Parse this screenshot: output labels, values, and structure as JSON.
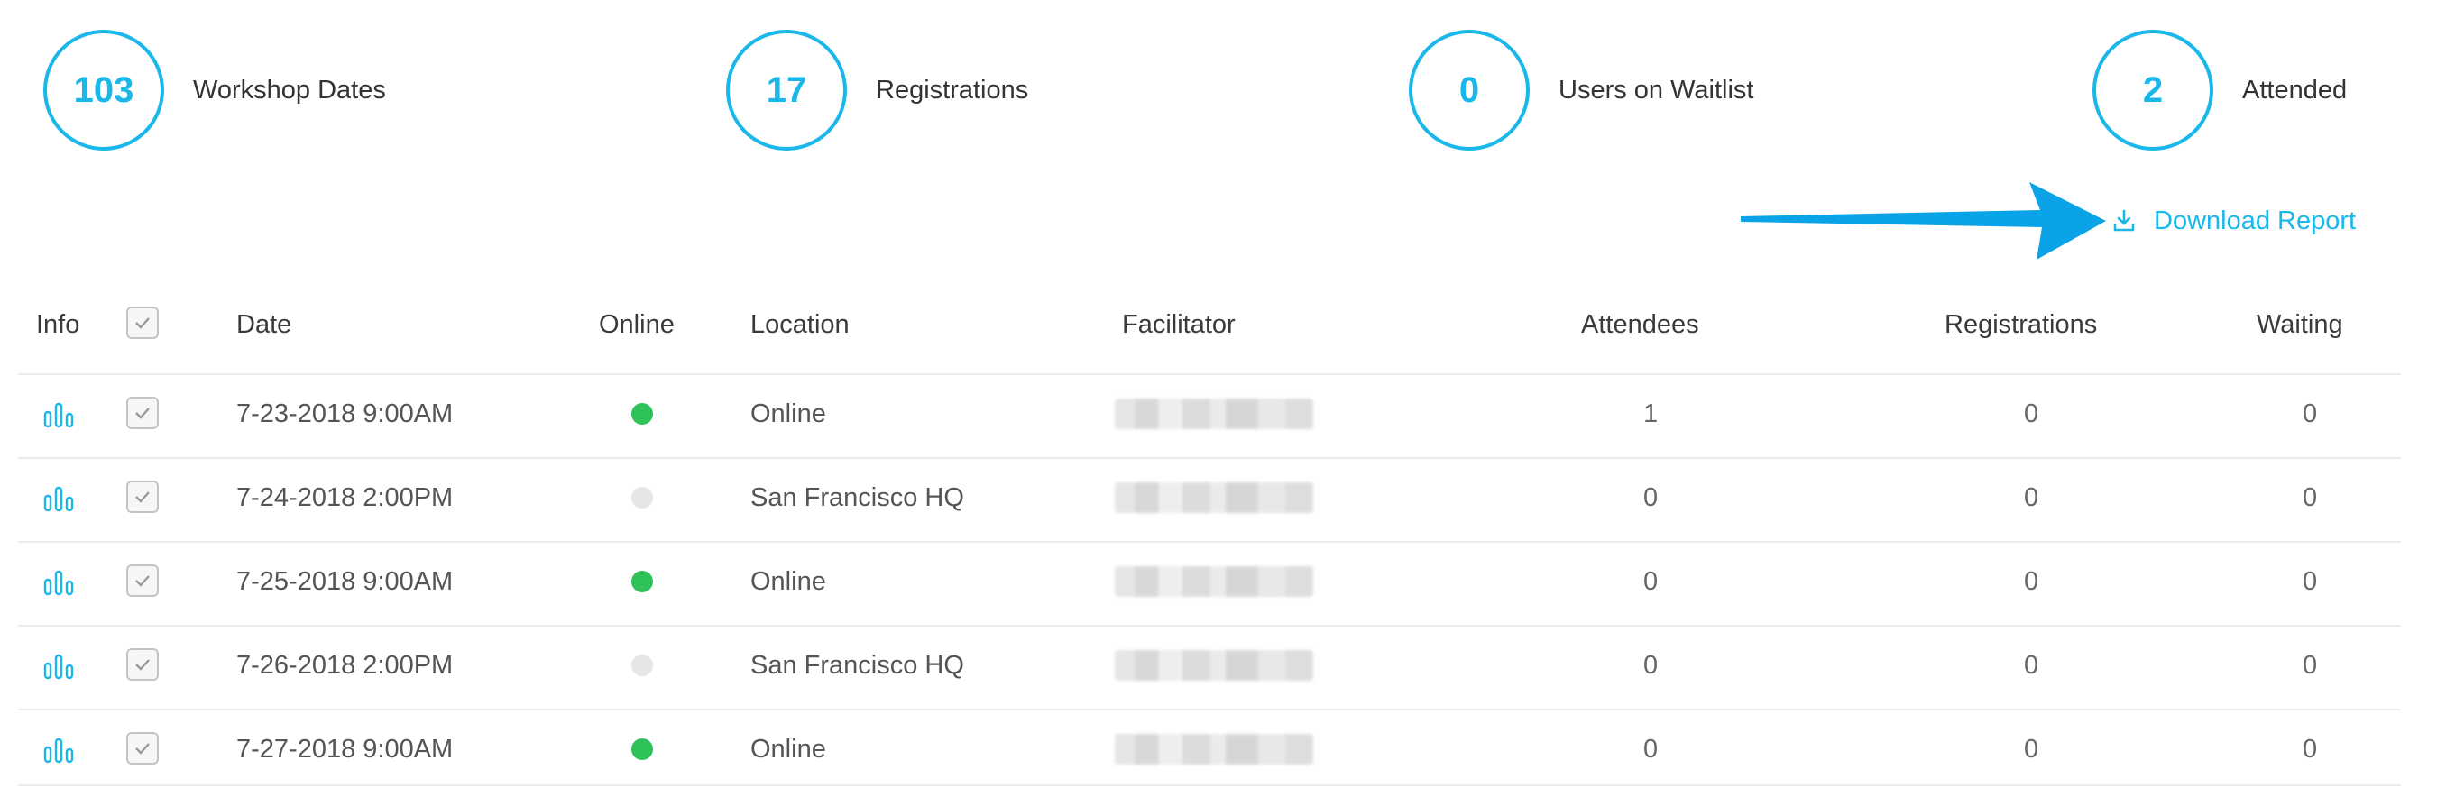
{
  "stats": [
    {
      "value": "103",
      "label": "Workshop Dates"
    },
    {
      "value": "17",
      "label": "Registrations"
    },
    {
      "value": "0",
      "label": "Users on Waitlist"
    },
    {
      "value": "2",
      "label": "Attended"
    }
  ],
  "download": {
    "label": "Download Report",
    "icon": "download-icon"
  },
  "table": {
    "headers": {
      "info": "Info",
      "date": "Date",
      "online": "Online",
      "location": "Location",
      "facilitator": "Facilitator",
      "attendees": "Attendees",
      "registrations": "Registrations",
      "waiting": "Waiting"
    },
    "rows": [
      {
        "date": "7-23-2018 9:00AM",
        "online": true,
        "location": "Online",
        "attendees": "1",
        "registrations": "0",
        "waiting": "0"
      },
      {
        "date": "7-24-2018 2:00PM",
        "online": false,
        "location": "San Francisco HQ",
        "attendees": "0",
        "registrations": "0",
        "waiting": "0"
      },
      {
        "date": "7-25-2018 9:00AM",
        "online": true,
        "location": "Online",
        "attendees": "0",
        "registrations": "0",
        "waiting": "0"
      },
      {
        "date": "7-26-2018 2:00PM",
        "online": false,
        "location": "San Francisco HQ",
        "attendees": "0",
        "registrations": "0",
        "waiting": "0"
      },
      {
        "date": "7-27-2018 9:00AM",
        "online": true,
        "location": "Online",
        "attendees": "0",
        "registrations": "0",
        "waiting": "0"
      }
    ]
  },
  "colors": {
    "accent": "#1ab7ea",
    "online": "#2fc25b",
    "offline": "#e6e6e6",
    "arrow": "#0aa3e8"
  }
}
